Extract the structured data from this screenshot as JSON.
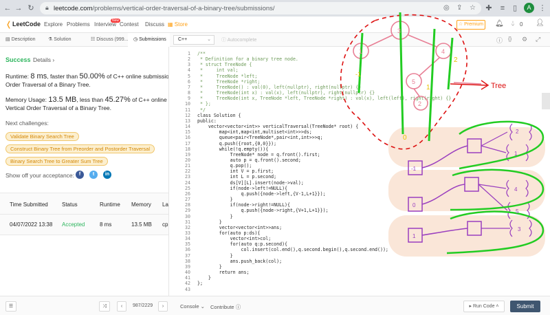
{
  "browser": {
    "url_host": "leetcode.com",
    "url_path": "/problems/vertical-order-traversal-of-a-binary-tree/submissions/",
    "avatar_letter": "A"
  },
  "nav": {
    "logo": "LeetCode",
    "items": [
      "Explore",
      "Problems",
      "Interview",
      "Contest",
      "Discuss",
      "Store"
    ],
    "new_badge": "New",
    "premium": "Premium",
    "coins": "0"
  },
  "left_tabs": [
    "Description",
    "Solution",
    "Discuss (999...",
    "Submissions"
  ],
  "result": {
    "status": "Success",
    "details": "Details",
    "runtime_prefix": "Runtime: ",
    "runtime_value": "8 ms",
    "runtime_mid": ", faster than ",
    "runtime_pct": "50.00%",
    "runtime_suffix": " of C++ online submissions for V",
    "runtime_line2": "Order Traversal of a Binary Tree.",
    "memory_prefix": "Memory Usage: ",
    "memory_value": "13.5 MB",
    "memory_mid": ", less than ",
    "memory_pct": "45.27%",
    "memory_suffix": " of C++ online submiss",
    "memory_line2": "Vertical Order Traversal of a Binary Tree."
  },
  "challenges": {
    "heading": "Next challenges:",
    "items": [
      "Validate Binary Search Tree",
      "Construct Binary Tree from Preorder and Postorder Traversal",
      "Binary Search Tree to Greater Sum Tree"
    ]
  },
  "share_label": "Show off your acceptance:",
  "table": {
    "headers": [
      "Time Submitted",
      "Status",
      "Runtime",
      "Memory",
      "La"
    ],
    "row": [
      "04/07/2022 13:38",
      "Accepted",
      "8 ms",
      "13.5 MB",
      "cp"
    ]
  },
  "editor": {
    "language": "C++",
    "autocomplete": "Autocomplete",
    "line_numbers": [
      "1",
      "2",
      "3",
      "4",
      "5",
      "6",
      "7",
      "8",
      "9",
      "10",
      "11",
      "12",
      "13",
      "14",
      "15",
      "16",
      "17",
      "18",
      "19",
      "20",
      "21",
      "22",
      "23",
      "24",
      "25",
      "26",
      "27",
      "28",
      "29",
      "30",
      "31",
      "32",
      "33",
      "34",
      "35",
      "36",
      "37",
      "38",
      "39",
      "40",
      "41",
      "42",
      "43"
    ],
    "lines": [
      "/**",
      " * Definition for a binary tree node.",
      " * struct TreeNode {",
      " *     int val;",
      " *     TreeNode *left;",
      " *     TreeNode *right;",
      " *     TreeNode() : val(0), left(nullptr), right(nullptr) {}",
      " *     TreeNode(int x) : val(x), left(nullptr), right(nullptr) {}",
      " *     TreeNode(int x, TreeNode *left, TreeNode *right) : val(x), left(left), right(right) {}",
      " * };",
      " */",
      "class Solution {",
      "public:",
      "    vector<vector<int>> verticalTraversal(TreeNode* root) {",
      "        map<int,map<int,multiset<int>>>ds;",
      "        queue<pair<TreeNode*,pair<int,int>>>q;",
      "        q.push({root,{0,0}});",
      "        while(!q.empty()){",
      "            TreeNode* node = q.front().first;",
      "            auto p = q.front().second;",
      "            q.pop();",
      "            int V = p.first;",
      "            int L = p.second;",
      "            ds[V][L].insert(node->val);",
      "            if(node->left!=NULL){",
      "                q.push({node->left,{V-1,L+1}});",
      "            }",
      "            if(node->right!=NULL){",
      "                q.push({node->right,{V+1,L+1}});",
      "            }",
      "        }",
      "        vector<vector<int>>ans;",
      "        for(auto p:ds){",
      "            vector<int>col;",
      "            for(auto q:p.second){",
      "                col.insert(col.end(),q.second.begin(),q.second.end());",
      "            }",
      "            ans.push_back(col);",
      "        }",
      "        return ans;",
      "    }",
      "};",
      ""
    ]
  },
  "annotation": {
    "tree_label": "Tree",
    "col_labels": [
      "-1",
      "0",
      "1",
      "2"
    ],
    "node_labels": [
      "3",
      "1",
      "4",
      "5",
      "2",
      "3"
    ],
    "box_labels": [
      "-1",
      "0",
      "1",
      "2",
      "4",
      "5",
      "3",
      "2"
    ]
  },
  "bottom": {
    "problem_counter": "987/2229",
    "console": "Console",
    "contribute": "Contribute",
    "run_code": "Run Code",
    "submit": "Submit"
  },
  "colors": {
    "accent_orange": "#ffa116",
    "success_green": "#2db55d",
    "link_blue": "#007aff",
    "ink_pink": "#e87f95",
    "ink_green": "#22cc22",
    "ink_purple": "#9a3fbf",
    "ink_red": "#dd1111",
    "highlight_peach": "#f5d1b8"
  }
}
